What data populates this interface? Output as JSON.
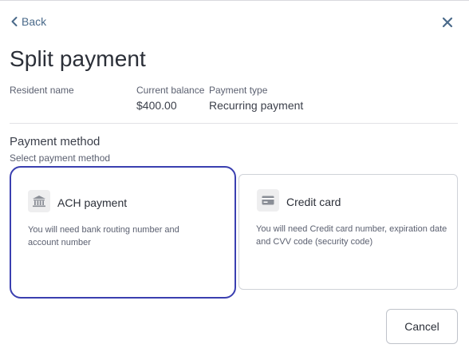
{
  "nav": {
    "back_label": "Back"
  },
  "header": {
    "title": "Split payment"
  },
  "summary": {
    "resident_name_label": "Resident name",
    "resident_name_value": "",
    "balance_label": "Current balance",
    "balance_value": "$400.00",
    "payment_type_label": "Payment type",
    "payment_type_value": "Recurring payment"
  },
  "payment_method": {
    "title": "Payment method",
    "subtitle": "Select payment method",
    "options": [
      {
        "title": "ACH payment",
        "description": "You will need bank routing number and account number",
        "icon": "bank-icon",
        "selected": true
      },
      {
        "title": "Credit card",
        "description": "You will need Credit card number, expiration date and CVV code (security code)",
        "icon": "credit-card-icon",
        "selected": false
      }
    ]
  },
  "actions": {
    "cancel_label": "Cancel"
  },
  "colors": {
    "accent": "#3a3fb0",
    "link": "#4a6a8a",
    "text": "#2b2f38",
    "muted": "#5b6070"
  }
}
